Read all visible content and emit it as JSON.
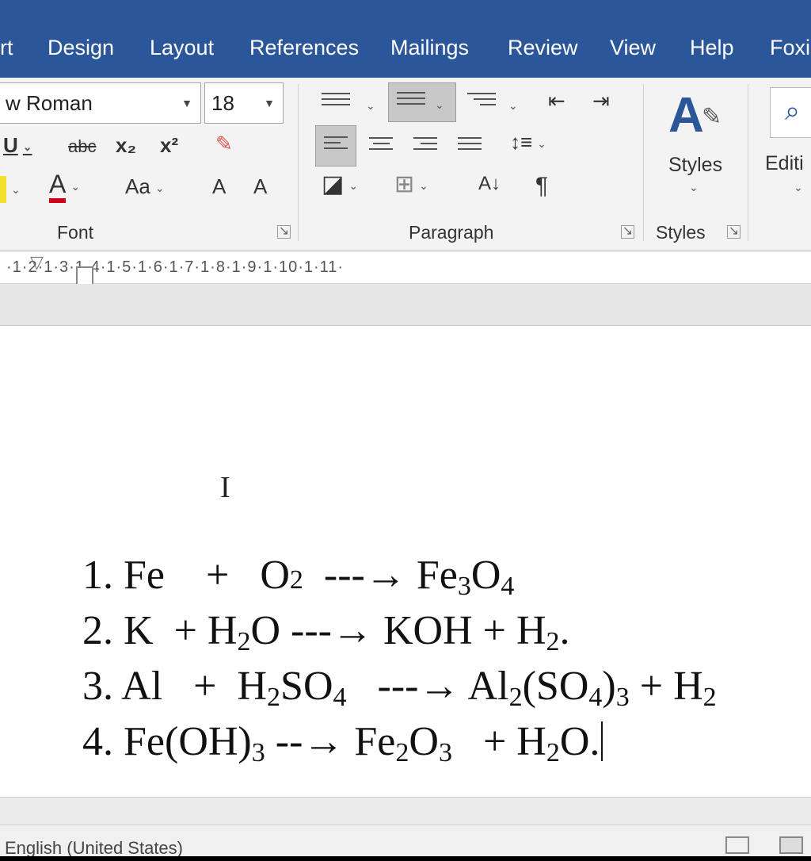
{
  "ribbon_tabs": [
    "rt",
    "Design",
    "Layout",
    "References",
    "Mailings",
    "Review",
    "View",
    "Help",
    "Foxi"
  ],
  "font": {
    "name": "w Roman",
    "size": "18",
    "bold_underline": "U",
    "strike": "abc",
    "subscript": "x₂",
    "superscript": "x²",
    "font_color_letter": "A",
    "change_case": "Aa",
    "grow": "A",
    "shrink": "A",
    "label": "Font"
  },
  "paragraph": {
    "label": "Paragraph",
    "sort": "A↓",
    "pilcrow": "¶"
  },
  "styles": {
    "button_label": "Styles",
    "group_label": "Styles"
  },
  "editing": {
    "label": "Editi"
  },
  "ruler": {
    "marks": "·1·2·1·3·1·4·1·5·1·6·1·7·1·8·1·9·1·10·1·11·"
  },
  "document": {
    "lines": [
      {
        "num": "1.",
        "parts": [
          "Fe",
          " + ",
          "O",
          "2",
          " ---→ ",
          "Fe",
          "3",
          "O",
          "4"
        ]
      },
      {
        "num": "2.",
        "parts": [
          "K",
          " + ",
          "H",
          "2",
          "O",
          " ---→ ",
          "KOH",
          " + ",
          "H",
          "2",
          "."
        ]
      },
      {
        "num": "3.",
        "parts": [
          "Al",
          " + ",
          "H",
          "2",
          "SO",
          "4",
          " ---→ ",
          "Al",
          "2",
          "(SO",
          "4",
          ")",
          "3",
          " + ",
          "H",
          "2"
        ]
      },
      {
        "num": "4.",
        "parts": [
          "Fe(OH)",
          "3",
          " --→ ",
          "Fe",
          "2",
          "O",
          "3",
          " + ",
          "H",
          "2",
          "O."
        ]
      }
    ]
  },
  "status": {
    "language": "English (United States)"
  }
}
